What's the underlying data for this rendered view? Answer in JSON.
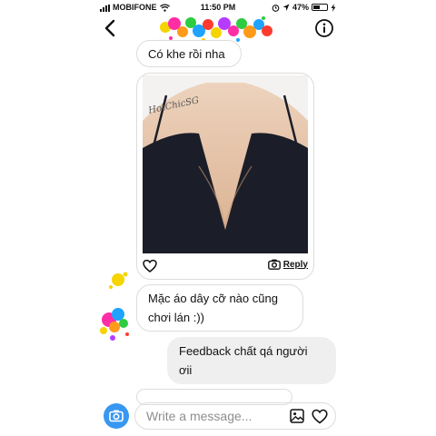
{
  "status_bar": {
    "carrier": "MOBIFONE",
    "time": "11:50 PM",
    "battery_text": "47%",
    "battery_level": 0.47,
    "icons": [
      "signal-icon",
      "wifi-icon",
      "alarm-icon",
      "location-icon",
      "battery-icon",
      "charging-icon"
    ]
  },
  "header": {
    "back_icon": "chevron-left-icon",
    "info_icon": "info-circle-icon",
    "name_cover": "paint-splash-sticker"
  },
  "messages": [
    {
      "id": "m1",
      "side": "received",
      "text": "Có khe rồi nha"
    },
    {
      "id": "m2",
      "side": "received",
      "type": "shared-photo",
      "watermark": "HotChicSG",
      "reply_label": "Reply"
    },
    {
      "id": "m3",
      "side": "received",
      "text_lines": [
        "Mặc áo dây cỡ nào cũng",
        "chơi lán :))"
      ]
    },
    {
      "id": "m4",
      "side": "sent",
      "text_lines": [
        "Feedback chất qá người",
        "ơii"
      ]
    },
    {
      "id": "m5",
      "side": "received",
      "text": ""
    }
  ],
  "composer": {
    "placeholder": "Write a message...",
    "value": "",
    "icons": [
      "camera-icon",
      "gallery-icon",
      "heart-icon"
    ]
  },
  "colors": {
    "accent": "#3897f0",
    "sent_bubble": "#efefef",
    "received_border": "#dcdcdc",
    "garment": "#1b1e28",
    "skin": "#e6c2a4",
    "placeholder": "#8e8e8e"
  }
}
